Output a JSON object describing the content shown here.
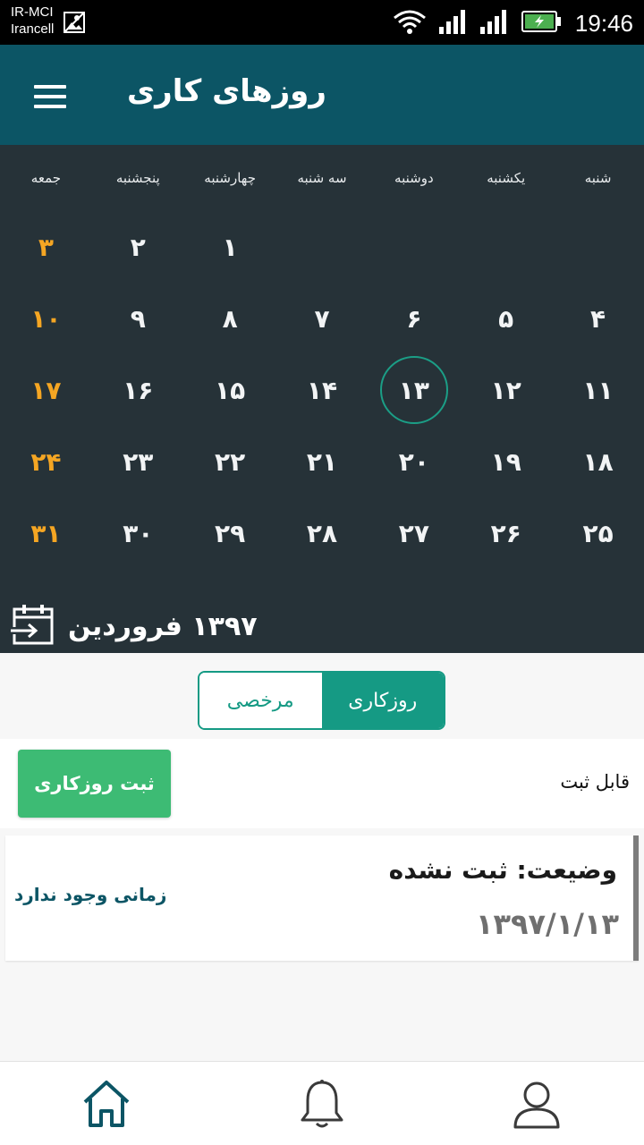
{
  "status_bar": {
    "carrier_line1": "IR-MCI",
    "carrier_line2": "Irancell",
    "time": "19:46",
    "icons": [
      "image-icon",
      "wifi-icon",
      "signal-icon",
      "signal-icon",
      "battery-charging-icon"
    ]
  },
  "app_bar": {
    "title": "روزهای کاری",
    "menu_icon": "menu-icon"
  },
  "calendar": {
    "weekdays": [
      "شنبه",
      "یکشنبه",
      "دوشنبه",
      "سه شنبه",
      "چهارشنبه",
      "پنجشنبه",
      "جمعه"
    ],
    "weeks": [
      [
        "",
        "",
        "",
        "",
        "۱",
        "۲",
        "۳"
      ],
      [
        "۴",
        "۵",
        "۶",
        "۷",
        "۸",
        "۹",
        "۱۰"
      ],
      [
        "۱۱",
        "۱۲",
        "۱۳",
        "۱۴",
        "۱۵",
        "۱۶",
        "۱۷"
      ],
      [
        "۱۸",
        "۱۹",
        "۲۰",
        "۲۱",
        "۲۲",
        "۲۳",
        "۲۴"
      ],
      [
        "۲۵",
        "۲۶",
        "۲۷",
        "۲۸",
        "۲۹",
        "۳۰",
        "۳۱"
      ]
    ],
    "selected_day": "۱۳",
    "month_label": "۱۳۹۷ فروردین",
    "month_icon": "calendar-export-icon",
    "friday_color": "#f5a623",
    "background": "#263238"
  },
  "tabs": {
    "active": "روزکاری",
    "inactive": "مرخصی"
  },
  "action": {
    "submit_label": "ثبت روزکاری",
    "registrable_label": "قابل ثبت"
  },
  "status_card": {
    "status": "وضیعت: ثبت نشده",
    "date": "۱۳۹۷/۱/۱۳",
    "no_time": "زمانی وجود ندارد"
  },
  "bottom_nav": {
    "items": [
      "home-icon",
      "bell-icon",
      "profile-icon"
    ],
    "accent": "#0c5565"
  }
}
